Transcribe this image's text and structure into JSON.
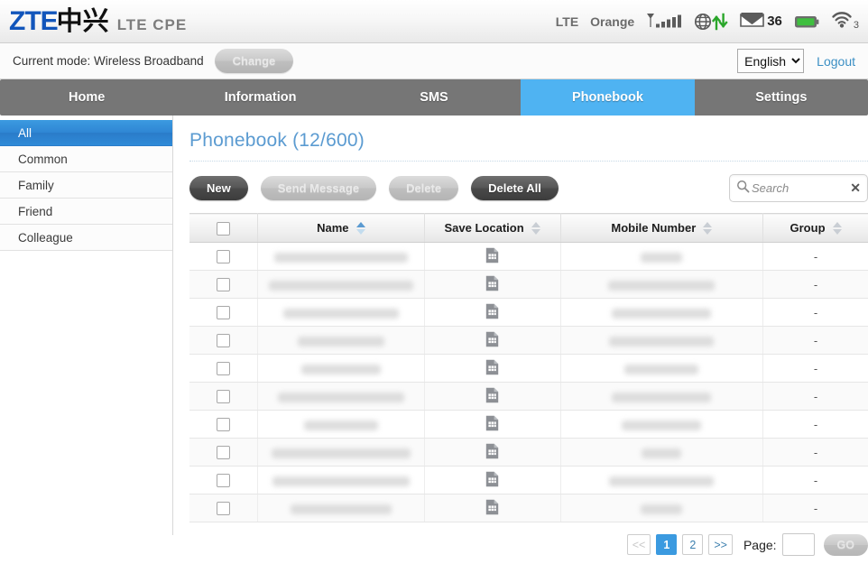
{
  "header": {
    "brand_zte": "ZTE",
    "brand_cn": "中兴",
    "model": "LTE CPE",
    "status": {
      "network_type": "LTE",
      "carrier": "Orange",
      "signal_icon": "signal-bars-icon",
      "signal_bars": 5,
      "globe_icon": "globe-data-transfer-icon",
      "mail_icon": "envelope-icon",
      "mail_count": "36",
      "battery_icon": "battery-icon",
      "wifi_icon": "wifi-icon",
      "wifi_clients": "3"
    }
  },
  "modebar": {
    "mode_text": "Current mode: Wireless Broadband",
    "change_label": "Change",
    "change_disabled": true,
    "language_selected": "English",
    "language_options": [
      "English"
    ],
    "logout_label": "Logout"
  },
  "nav": {
    "items": [
      {
        "label": "Home",
        "active": false
      },
      {
        "label": "Information",
        "active": false
      },
      {
        "label": "SMS",
        "active": false
      },
      {
        "label": "Phonebook",
        "active": true
      },
      {
        "label": "Settings",
        "active": false
      }
    ]
  },
  "sidebar": {
    "items": [
      {
        "label": "All",
        "active": true
      },
      {
        "label": "Common",
        "active": false
      },
      {
        "label": "Family",
        "active": false
      },
      {
        "label": "Friend",
        "active": false
      },
      {
        "label": "Colleague",
        "active": false
      }
    ]
  },
  "main": {
    "title": "Phonebook (12/600)",
    "toolbar": {
      "new_label": "New",
      "send_message_label": "Send Message",
      "delete_label": "Delete",
      "delete_all_label": "Delete All"
    },
    "search": {
      "placeholder": "Search",
      "value": "",
      "icon": "search-icon",
      "clear_icon": "clear-icon",
      "clear_glyph": "✕"
    },
    "table": {
      "columns": [
        {
          "key": "checkbox",
          "label": "",
          "sortable": false
        },
        {
          "key": "name",
          "label": "Name",
          "sortable": true,
          "sort_active": true
        },
        {
          "key": "location",
          "label": "Save Location",
          "sortable": true,
          "sort_active": false
        },
        {
          "key": "number",
          "label": "Mobile Number",
          "sortable": true,
          "sort_active": false
        },
        {
          "key": "group",
          "label": "Group",
          "sortable": true,
          "sort_active": false
        }
      ],
      "rows": [
        {
          "name": "",
          "name_redacted": true,
          "name_width": 148,
          "location_icon": "sim-card-icon",
          "number": "",
          "number_redacted": true,
          "number_width": 46,
          "group": "-"
        },
        {
          "name": "",
          "name_redacted": true,
          "name_width": 160,
          "location_icon": "sim-card-icon",
          "number": "",
          "number_redacted": true,
          "number_width": 118,
          "group": "-"
        },
        {
          "name": "",
          "name_redacted": true,
          "name_width": 128,
          "location_icon": "sim-card-icon",
          "number": "",
          "number_redacted": true,
          "number_width": 110,
          "group": "-"
        },
        {
          "name": "",
          "name_redacted": true,
          "name_width": 96,
          "location_icon": "sim-card-icon",
          "number": "",
          "number_redacted": true,
          "number_width": 116,
          "group": "-"
        },
        {
          "name": "",
          "name_redacted": true,
          "name_width": 88,
          "location_icon": "sim-card-icon",
          "number": "",
          "number_redacted": true,
          "number_width": 82,
          "group": "-"
        },
        {
          "name": "",
          "name_redacted": true,
          "name_width": 140,
          "location_icon": "sim-card-icon",
          "number": "",
          "number_redacted": true,
          "number_width": 110,
          "group": "-"
        },
        {
          "name": "",
          "name_redacted": true,
          "name_width": 82,
          "location_icon": "sim-card-icon",
          "number": "",
          "number_redacted": true,
          "number_width": 88,
          "group": "-"
        },
        {
          "name": "",
          "name_redacted": true,
          "name_width": 154,
          "location_icon": "sim-card-icon",
          "number": "",
          "number_redacted": true,
          "number_width": 44,
          "group": "-"
        },
        {
          "name": "",
          "name_redacted": true,
          "name_width": 152,
          "location_icon": "sim-card-icon",
          "number": "",
          "number_redacted": true,
          "number_width": 116,
          "group": "-"
        },
        {
          "name": "",
          "name_redacted": true,
          "name_width": 112,
          "location_icon": "sim-card-icon",
          "number": "",
          "number_redacted": true,
          "number_width": 46,
          "group": "-"
        }
      ]
    },
    "pagination": {
      "prev_label": "<<",
      "next_label": ">>",
      "pages": [
        {
          "label": "1",
          "active": true
        },
        {
          "label": "2",
          "active": false
        }
      ],
      "page_label": "Page:",
      "page_value": "",
      "go_label": "GO",
      "prev_disabled": true
    }
  },
  "colors": {
    "accent_blue": "#3b9ae0",
    "tab_active": "#4fb3f2",
    "title_blue": "#5b9bd1",
    "nav_gray": "#767676",
    "link_blue": "#3b8fc4",
    "status_green": "#2aa62a"
  }
}
